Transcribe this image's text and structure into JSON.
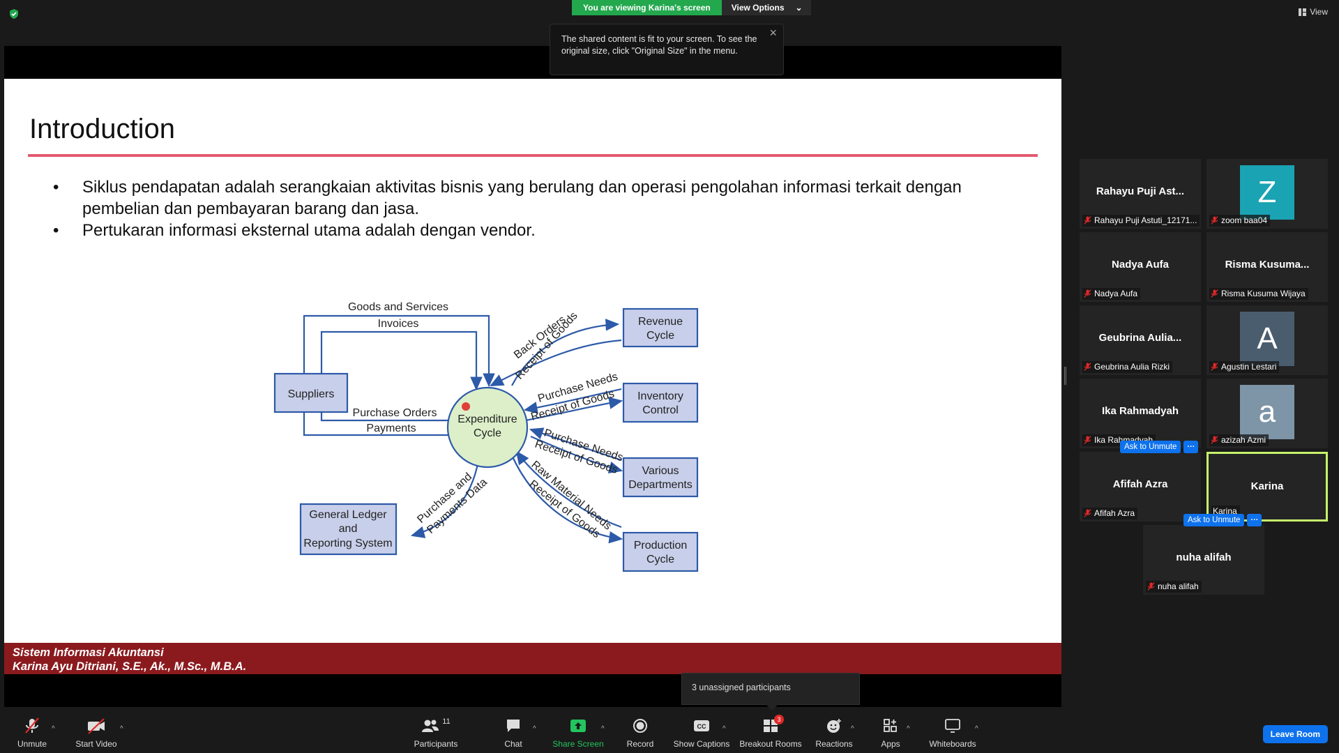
{
  "banner": {
    "viewing": "You are viewing Karina's screen",
    "view_options": "View Options"
  },
  "top_right": {
    "view_label": "View"
  },
  "tooltip": {
    "text": "The shared content is fit to your screen. To see the original size, click \"Original Size\" in the menu."
  },
  "slide": {
    "title": "Introduction",
    "bullets": [
      "Siklus pendapatan adalah serangkaian aktivitas bisnis yang berulang dan operasi pengolahan informasi terkait dengan pembelian dan pembayaran barang dan jasa.",
      "Pertukaran informasi eksternal utama adalah dengan vendor."
    ],
    "diagram": {
      "center": [
        "Expenditure",
        "Cycle"
      ],
      "suppliers": "Suppliers",
      "gl": [
        "General Ledger",
        "and",
        "Reporting System"
      ],
      "revenue": [
        "Revenue",
        "Cycle"
      ],
      "inventory": [
        "Inventory",
        "Control"
      ],
      "various": [
        "Various",
        "Departments"
      ],
      "production": [
        "Production",
        "Cycle"
      ],
      "flows": {
        "goods_services": "Goods and Services",
        "invoices": "Invoices",
        "purchase_orders": "Purchase Orders",
        "payments": "Payments",
        "back_orders": "Back Orders",
        "receipt_goods_1": "Receipt of Goods",
        "purchase_needs_1": "Purchase Needs",
        "receipt_goods_2": "Receipt of Goods",
        "purchase_needs_2": "Purchase Needs",
        "receipt_goods_3": "Receipt of Goods",
        "raw_material": "Raw Material Needs",
        "receipt_goods_4": "Receipt of Goods",
        "purchase_and": "Purchase and",
        "payments_data": "Payments Data"
      }
    },
    "footer": {
      "line1": "Sistem Informasi Akuntansi",
      "line2": "Karina Ayu Ditriani, S.E., Ak., M.Sc., M.B.A."
    }
  },
  "unassigned": "3 unassigned participants",
  "gallery": [
    {
      "name": "Rahayu Puji Ast...",
      "label": "Rahayu Puji Astuti_12171..."
    },
    {
      "avatar": "Z",
      "label": "zoom baa04",
      "color": "#1aa3b3"
    },
    {
      "name": "Nadya Aufa",
      "label": "Nadya Aufa"
    },
    {
      "name": "Risma Kusuma...",
      "label": "Risma Kusuma Wijaya"
    },
    {
      "name": "Geubrina  Aulia...",
      "label": "Geubrina Aulia Rizki"
    },
    {
      "avatar": "A",
      "label": "Agustin Lestari",
      "color": "#4a5d6e"
    },
    {
      "name": "Ika Rahmadyah",
      "label": "Ika Rahmadyah"
    },
    {
      "avatar": "a",
      "label": "azizah Azmi",
      "color": "#7e95a8"
    },
    {
      "name": "Afifah Azra",
      "label": "Afifah Azra",
      "ask": "Ask to Unmute",
      "more": "···"
    },
    {
      "name": "Karina",
      "label": "Karina",
      "active": true
    },
    {
      "name": "nuha alifah",
      "label": "nuha alifah",
      "ask": "Ask to Unmute",
      "more": "···"
    }
  ],
  "toolbar": {
    "unmute": "Unmute",
    "start_video": "Start Video",
    "participants": "Participants",
    "participants_count": "11",
    "chat": "Chat",
    "share_screen": "Share Screen",
    "record": "Record",
    "show_captions": "Show Captions",
    "breakout_rooms": "Breakout Rooms",
    "breakout_badge": "3",
    "reactions": "Reactions",
    "apps": "Apps",
    "whiteboards": "Whiteboards",
    "leave": "Leave Room"
  },
  "colors": {
    "zoom_green": "#23a84e",
    "zoom_blue": "#0e72ed",
    "slide_footer": "#8b1a1e",
    "title_rule": "#e35b6e",
    "active_speaker": "#c8f26b"
  }
}
